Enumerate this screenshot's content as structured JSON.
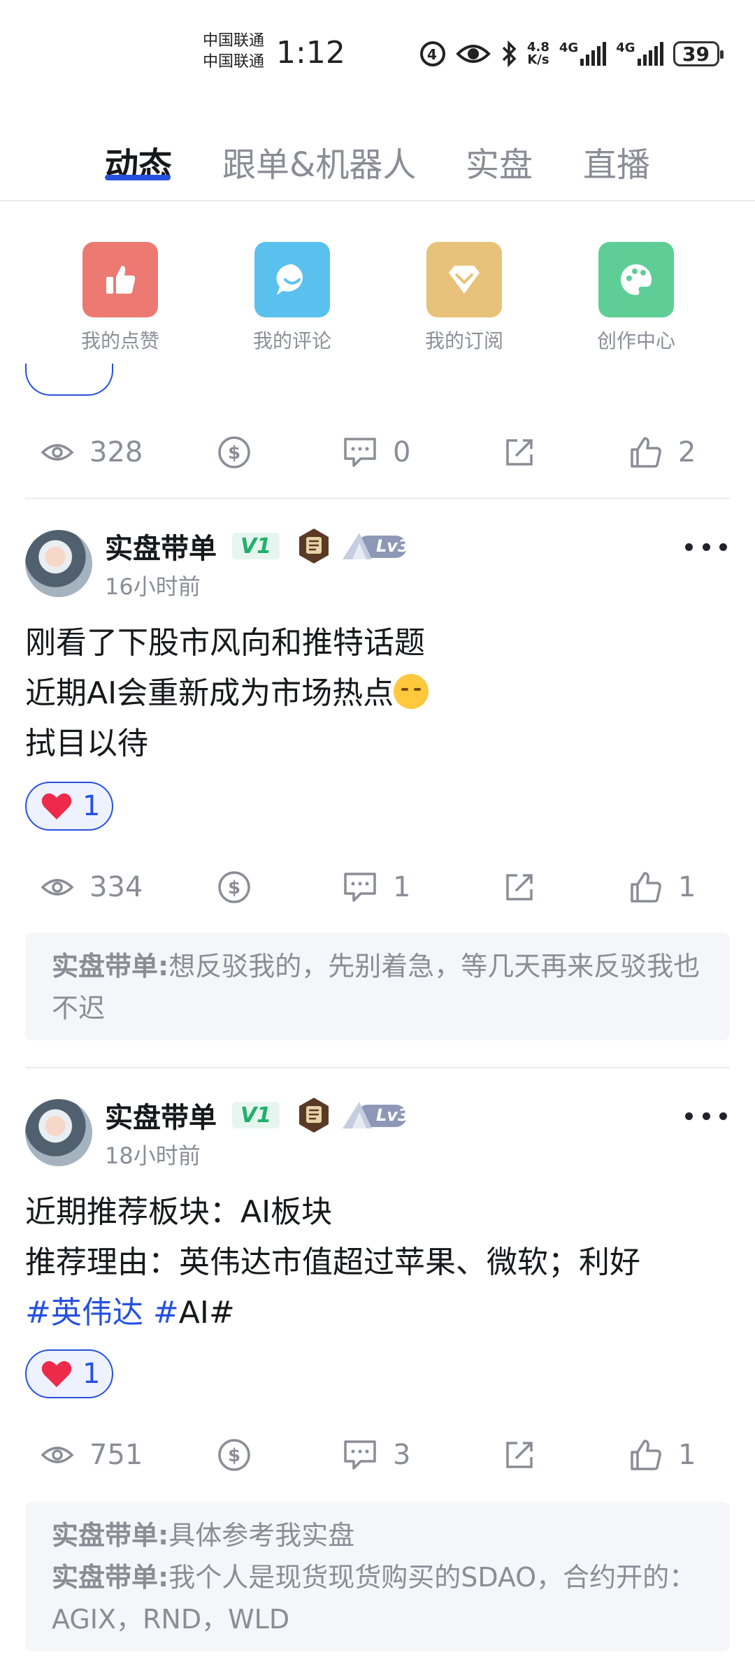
{
  "status_bar": {
    "carrier1": "中国联通",
    "carrier2": "中国联通",
    "time": "1:12",
    "net_speed_value": "4.8",
    "net_speed_unit": "K/s",
    "signal1": "4G",
    "signal2": "4G",
    "battery": "39"
  },
  "tabs": [
    {
      "label": "动态",
      "active": true
    },
    {
      "label": "跟单&机器人",
      "active": false
    },
    {
      "label": "实盘",
      "active": false
    },
    {
      "label": "直播",
      "active": false
    }
  ],
  "quick_actions": [
    {
      "label": "我的点赞",
      "icon": "thumbs-up-icon",
      "color": "#ec7a73"
    },
    {
      "label": "我的评论",
      "icon": "comment-icon",
      "color": "#5ac1ee"
    },
    {
      "label": "我的订阅",
      "icon": "diamond-icon",
      "color": "#e8c27a"
    },
    {
      "label": "创作中心",
      "icon": "palette-icon",
      "color": "#5fce96"
    }
  ],
  "top_post_actions": {
    "views": "328",
    "comments": "0",
    "likes": "2"
  },
  "posts": [
    {
      "author": "实盘带单",
      "vip": "V1",
      "level": "Lv3",
      "time": "16小时前",
      "lines": [
        "刚看了下股市风向和推特话题",
        "近期AI会重新成为市场热点",
        "拭目以待"
      ],
      "reaction_count": "1",
      "views": "334",
      "comments": "1",
      "likes": "1",
      "comment_preview": [
        {
          "author": "实盘带单:",
          "text": "想反驳我的，先别着急，等几天再来反驳我也不迟"
        }
      ]
    },
    {
      "author": "实盘带单",
      "vip": "V1",
      "level": "Lv3",
      "time": "18小时前",
      "lines": [
        "近期推荐板块：AI板块",
        "推荐理由：英伟达市值超过苹果、微软；利好"
      ],
      "tag1": "#英伟达",
      "tag2": "#",
      "tag_tail": "AI#",
      "reaction_count": "1",
      "views": "751",
      "comments": "3",
      "likes": "1",
      "comment_preview": [
        {
          "author": "实盘带单:",
          "text": "具体参考我实盘"
        },
        {
          "author": "实盘带单:",
          "text": "我个人是现货现货购买的SDAO，合约开的：AGIX，RND，WLD"
        }
      ]
    }
  ]
}
